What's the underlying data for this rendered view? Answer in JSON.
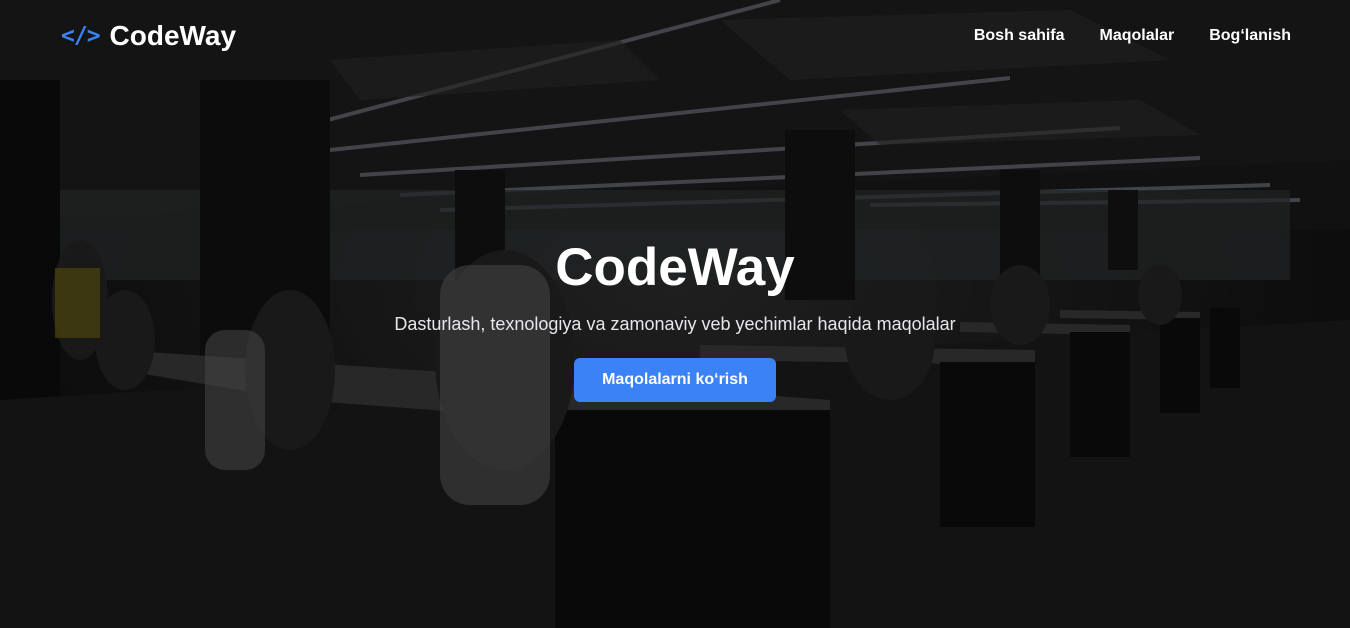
{
  "brand": {
    "icon": "</>",
    "name": "CodeWay"
  },
  "nav": {
    "items": [
      "Bosh sahifa",
      "Maqolalar",
      "Bog‘lanish"
    ]
  },
  "hero": {
    "title": "CodeWay",
    "subtitle": "Dasturlash, texnologiya va zamonaviy veb yechimlar haqida maqolalar",
    "cta_label": "Maqolalarni ko‘rish",
    "background": "office-photo"
  },
  "colors": {
    "accent": "#3b82f6",
    "text": "#ffffff"
  }
}
